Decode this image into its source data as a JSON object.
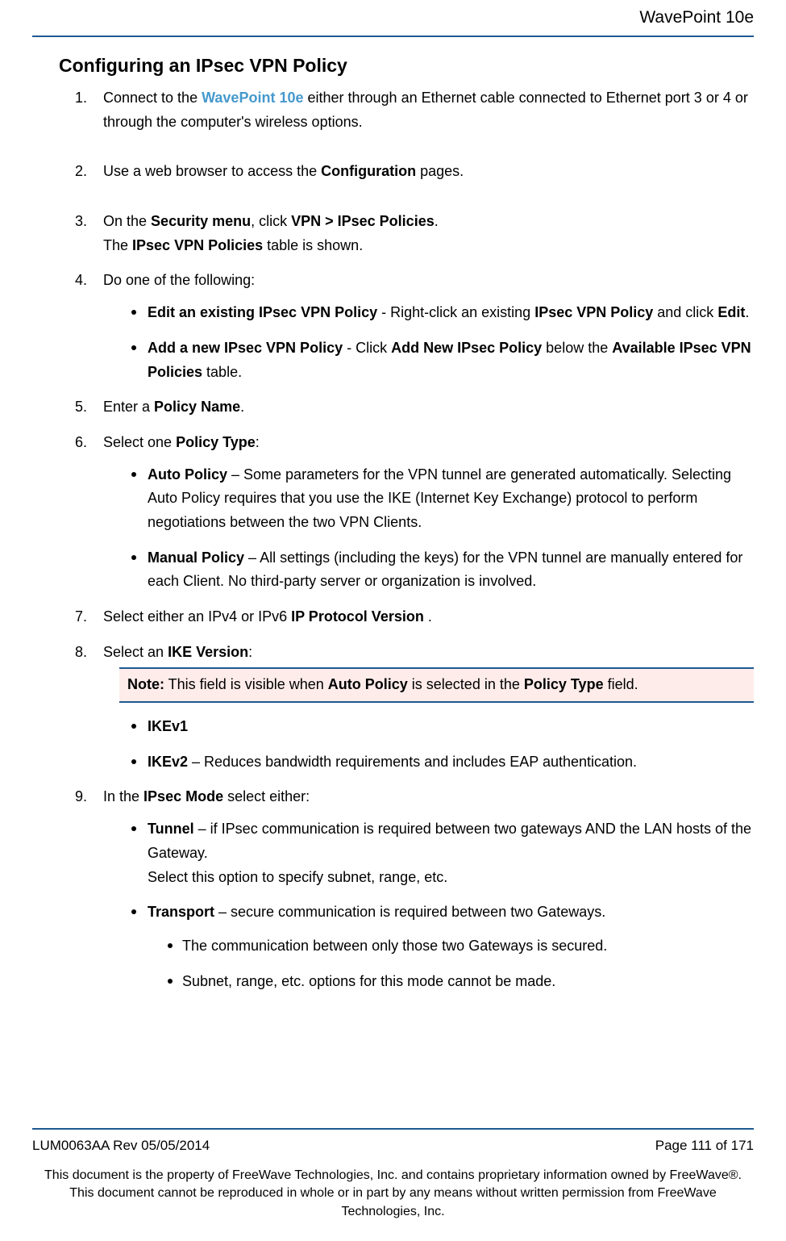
{
  "header": {
    "product": "WavePoint 10e"
  },
  "section": {
    "title": "Configuring an IPsec VPN Policy"
  },
  "steps": {
    "s1_a": "Connect to the ",
    "s1_link": "WavePoint 10e",
    "s1_b": " either through an Ethernet cable connected to Ethernet port 3 or 4 or through the computer's wireless options.",
    "s2_a": "Use a web browser to access the ",
    "s2_bold": "Configuration",
    "s2_b": " pages.",
    "s3_a": "On the ",
    "s3_b1": "Security menu",
    "s3_c": ", click ",
    "s3_b2": "VPN > IPsec Policies",
    "s3_d": ".",
    "s3_line2a": "The ",
    "s3_line2b": "IPsec VPN Policies",
    "s3_line2c": " table is shown.",
    "s4": "Do one of the following:",
    "s4_b1_a": "Edit an existing IPsec VPN Policy",
    "s4_b1_b": " - Right-click an existing ",
    "s4_b1_c": "IPsec VPN Policy",
    "s4_b1_d": " and click ",
    "s4_b1_e": "Edit",
    "s4_b1_f": ".",
    "s4_b2_a": "Add a new IPsec VPN Policy",
    "s4_b2_b": " - Click ",
    "s4_b2_c": "Add New IPsec Policy",
    "s4_b2_d": " below the ",
    "s4_b2_e": "Available IPsec VPN Policies",
    "s4_b2_f": " table.",
    "s5_a": "Enter a ",
    "s5_b": "Policy Name",
    "s5_c": ".",
    "s6_a": "Select one ",
    "s6_b": "Policy Type",
    "s6_c": ":",
    "s6_b1_a": "Auto Policy",
    "s6_b1_b": " – Some parameters for the VPN tunnel are generated automatically. Selecting Auto Policy requires that you use the IKE (Internet Key Exchange) protocol to perform negotiations between the two VPN Clients.",
    "s6_b2_a": "Manual Policy",
    "s6_b2_b": " – All settings (including the keys) for the VPN tunnel are manually entered for each Client. No third-party server or organization is involved.",
    "s7_a": "Select either an IPv4 or IPv6 ",
    "s7_b": "IP Protocol Version ",
    "s7_c": ".",
    "s8_a": "Select an ",
    "s8_b": "IKE Version",
    "s8_c": ":",
    "note_a": "Note:",
    "note_b": " This field is visible when ",
    "note_c": "Auto Policy",
    "note_d": " is selected in the ",
    "note_e": "Policy Type",
    "note_f": " field.",
    "s8_b1": "IKEv1",
    "s8_b2_sp": " ",
    "s8_b2_a": "IKEv2",
    "s8_b2_b": " – Reduces bandwidth requirements and includes EAP authentication.",
    "s9_a": "In the ",
    "s9_b": "IPsec Mode ",
    "s9_c": " select either:",
    "s9_b1_a": "Tunnel",
    "s9_b1_b": " – if IPsec communication is required between two gateways AND the LAN hosts of the Gateway.",
    "s9_b1_line2": "Select this option to specify subnet, range, etc.",
    "s9_b2_a": "Transport",
    "s9_b2_b": " – secure communication is required between two Gateways.",
    "s9_b2_i1": "The communication between only those two Gateways is secured.",
    "s9_b2_i2": "Subnet, range, etc. options for this mode cannot be made."
  },
  "footer": {
    "rev": "LUM0063AA Rev 05/05/2014",
    "page": "Page 111 of 171",
    "legal": "This document is the property of FreeWave Technologies, Inc. and contains proprietary information owned by FreeWave®. This document cannot be reproduced in whole or in part by any means without written permission from FreeWave Technologies, Inc."
  }
}
